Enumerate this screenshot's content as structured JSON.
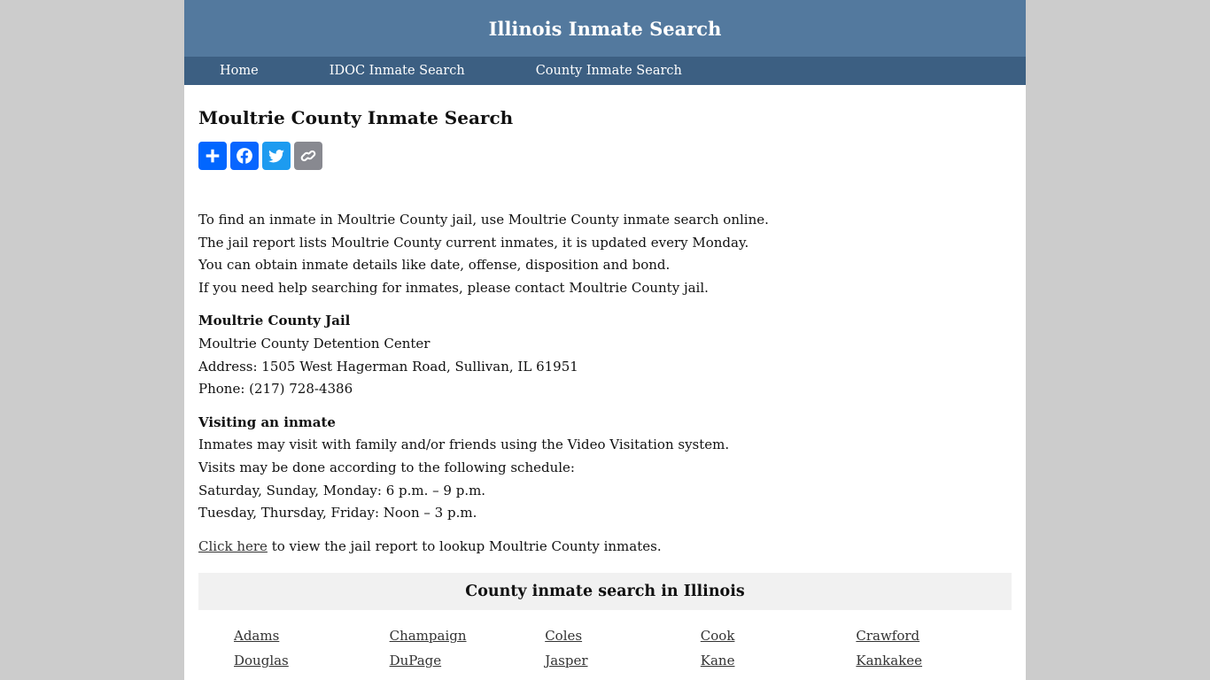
{
  "header": {
    "site_title": "Illinois Inmate Search"
  },
  "nav": {
    "items": [
      {
        "label": "Home"
      },
      {
        "label": "IDOC Inmate Search"
      },
      {
        "label": "County Inmate Search"
      }
    ]
  },
  "main": {
    "title": "Moultrie County Inmate Search",
    "share_buttons": [
      {
        "icon": "plus-icon",
        "label": "Share",
        "color": "#0166ff"
      },
      {
        "icon": "facebook-icon",
        "label": "Facebook",
        "color": "#0866ff"
      },
      {
        "icon": "twitter-icon",
        "label": "Twitter",
        "color": "#1d9bf0"
      },
      {
        "icon": "link-icon",
        "label": "Copy Link",
        "color": "#888990"
      }
    ],
    "intro": [
      "To find an inmate in Moultrie County jail, use Moultrie County inmate search online.",
      "The jail report lists Moultrie County current inmates, it is updated every Monday.",
      "You can obtain inmate details like date, offense, disposition and bond.",
      "If you need help searching for inmates, please contact Moultrie County jail."
    ],
    "jail": {
      "heading": "Moultrie County Jail",
      "name": "Moultrie County Detention Center",
      "address": "Address: 1505 West Hagerman Road, Sullivan, IL 61951",
      "phone": "Phone: (217) 728-4386"
    },
    "visiting": {
      "heading": "Visiting an inmate",
      "lines": [
        "Inmates may visit with family and/or friends using the Video Visitation system.",
        "Visits may be done according to the following schedule:",
        "Saturday, Sunday, Monday: 6 p.m. – 9 p.m.",
        "Tuesday, Thursday, Friday: Noon – 3 p.m."
      ]
    },
    "cta": {
      "link_text": "Click here",
      "rest": " to view the jail report to lookup Moultrie County inmates."
    }
  },
  "counties": {
    "heading": "County inmate search in Illinois",
    "items": [
      "Adams",
      "Champaign",
      "Coles",
      "Cook",
      "Crawford",
      "Douglas",
      "DuPage",
      "Jasper",
      "Kane",
      "Kankakee"
    ]
  },
  "colors": {
    "header_bg": "#53799e",
    "nav_bg": "#3c5f82",
    "page_bg": "#cccccc",
    "county_box_bg": "#f1f1f1"
  }
}
